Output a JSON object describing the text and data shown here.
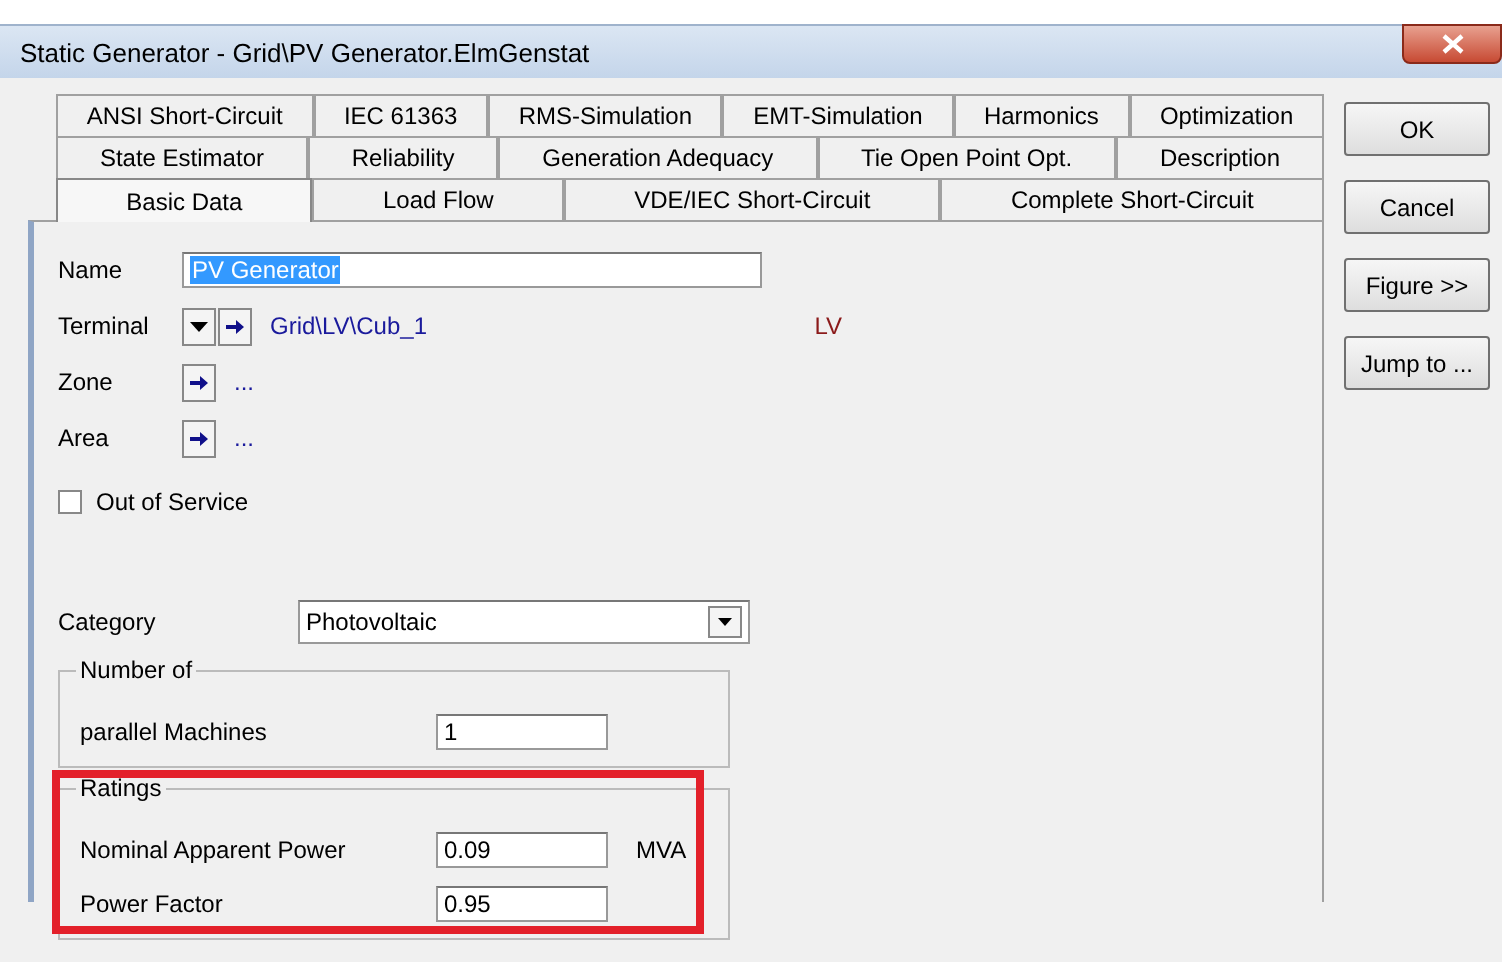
{
  "window": {
    "title": "Static Generator - Grid\\PV Generator.ElmGenstat"
  },
  "tab_rows": [
    [
      {
        "label": "ANSI Short-Circuit",
        "selected": false
      },
      {
        "label": "IEC 61363",
        "selected": false
      },
      {
        "label": "RMS-Simulation",
        "selected": false
      },
      {
        "label": "EMT-Simulation",
        "selected": false
      },
      {
        "label": "Harmonics",
        "selected": false
      },
      {
        "label": "Optimization",
        "selected": false
      }
    ],
    [
      {
        "label": "State Estimator",
        "selected": false
      },
      {
        "label": "Reliability",
        "selected": false
      },
      {
        "label": "Generation Adequacy",
        "selected": false
      },
      {
        "label": "Tie Open Point Opt.",
        "selected": false
      },
      {
        "label": "Description",
        "selected": false
      }
    ],
    [
      {
        "label": "Basic Data",
        "selected": true
      },
      {
        "label": "Load Flow",
        "selected": false
      },
      {
        "label": "VDE/IEC Short-Circuit",
        "selected": false
      },
      {
        "label": "Complete Short-Circuit",
        "selected": false
      }
    ]
  ],
  "buttons": [
    "OK",
    "Cancel",
    "Figure >>",
    "Jump to ..."
  ],
  "name": {
    "label": "Name",
    "value": "PV Generator",
    "text_selected": true
  },
  "links": [
    {
      "label": "Terminal",
      "dropdown": true,
      "target": "Grid\\LV\\Cub_1",
      "note": "LV"
    },
    {
      "label": "Zone",
      "dropdown": false,
      "target": "..."
    },
    {
      "label": "Area",
      "dropdown": false,
      "target": "..."
    }
  ],
  "out_of_service": {
    "label": "Out of Service",
    "checked": false
  },
  "category": {
    "label": "Category",
    "value": "Photovoltaic"
  },
  "groups": [
    {
      "title": "Number of",
      "highlighted": false,
      "fields": [
        {
          "label": "parallel Machines",
          "value": "1"
        }
      ]
    },
    {
      "title": "Ratings",
      "highlighted": true,
      "fields": [
        {
          "label": "Nominal Apparent Power",
          "value": "0.09",
          "unit": "MVA"
        },
        {
          "label": "Power Factor",
          "value": "0.95"
        }
      ]
    }
  ]
}
